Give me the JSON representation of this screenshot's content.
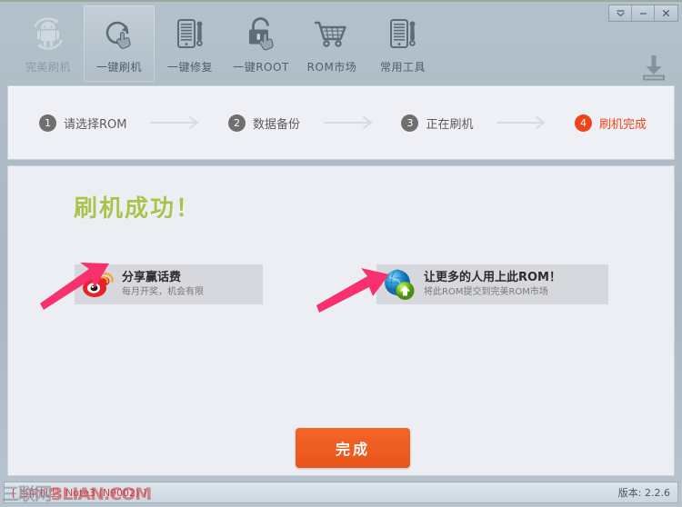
{
  "window": {
    "controls": [
      {
        "name": "tray-button",
        "glyph": "▼"
      },
      {
        "name": "minimize-button",
        "glyph": "—"
      },
      {
        "name": "close-button",
        "glyph": "✕"
      }
    ]
  },
  "toolbar": {
    "items": [
      {
        "id": "perfect-flash",
        "label": "完美刷机",
        "icon": "android-robot-icon",
        "selected": false,
        "dim": true
      },
      {
        "id": "one-key-flash",
        "label": "一键刷机",
        "icon": "one-key-flash-icon",
        "selected": true,
        "dim": false
      },
      {
        "id": "one-key-repair",
        "label": "一键修复",
        "icon": "phone-wrench-icon",
        "selected": false,
        "dim": false
      },
      {
        "id": "one-key-root",
        "label": "一键ROOT",
        "icon": "lock-hand-icon",
        "selected": false,
        "dim": false
      },
      {
        "id": "rom-market",
        "label": "ROM市场",
        "icon": "shopping-cart-icon",
        "selected": false,
        "dim": false
      },
      {
        "id": "common-tools",
        "label": "常用工具",
        "icon": "phone-wrench-icon",
        "selected": false,
        "dim": false
      }
    ],
    "download_icon": "download-icon"
  },
  "steps": [
    {
      "num": "1",
      "label": "请选择ROM",
      "active": false
    },
    {
      "num": "2",
      "label": "数据备份",
      "active": false
    },
    {
      "num": "3",
      "label": "正在刷机",
      "active": false
    },
    {
      "num": "4",
      "label": "刷机完成",
      "active": true
    }
  ],
  "main": {
    "success_title": "刷机成功！",
    "promos": [
      {
        "id": "weibo",
        "icon": "weibo-icon",
        "title": "分享赢话费",
        "subtitle": "每月开奖，机会有限"
      },
      {
        "id": "rom-submit",
        "icon": "globe-upload-icon",
        "title": "让更多的人用上此ROM！",
        "subtitle": "将此ROM提交到完美ROM市场"
      }
    ],
    "finish_button": "完成"
  },
  "statusbar": {
    "device_text": "[ 当前机型: Note3 (N9002) ]",
    "version_text": "版本: 2.2.6"
  },
  "watermark": {
    "cn": "三联网",
    "domain": "3LIAN.COM"
  },
  "colors": {
    "accent_orange": "#ea5418",
    "success_green": "#a8c44f",
    "arrow_pink": "#f7306e",
    "step_gray": "#6f6f6f"
  }
}
